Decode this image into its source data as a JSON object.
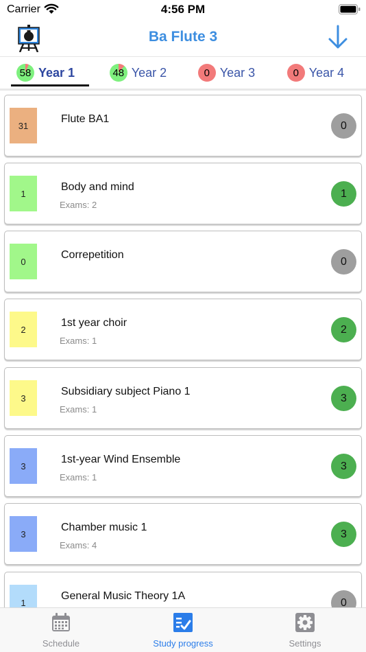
{
  "status_bar": {
    "carrier": "Carrier",
    "time": "4:56 PM"
  },
  "nav": {
    "title": "Ba Flute 3",
    "logo_icon": "easel-icon",
    "download_icon": "arrow-down-icon"
  },
  "year_tabs": [
    {
      "label": "Year 1",
      "count": "58",
      "active": true,
      "badge_color": "#7ef07e",
      "progress_color": "#f27a7a"
    },
    {
      "label": "Year 2",
      "count": "48",
      "active": false,
      "badge_color": "#7ef07e",
      "progress_color": "#f27a7a"
    },
    {
      "label": "Year 3",
      "count": "0",
      "active": false,
      "badge_color": "#f27a7a"
    },
    {
      "label": "Year 4",
      "count": "0",
      "active": false,
      "badge_color": "#f27a7a"
    }
  ],
  "courses": [
    {
      "name": "Flute BA1",
      "credits": "31",
      "exams": "",
      "count": "0",
      "color": "#ebb080",
      "count_color": "#9e9e9e"
    },
    {
      "name": "Body and mind",
      "credits": "1",
      "exams": "Exams: 2",
      "count": "1",
      "color": "#a1f78a",
      "count_color": "#4caf50"
    },
    {
      "name": "Correpetition",
      "credits": "0",
      "exams": "",
      "count": "0",
      "color": "#a1f78a",
      "count_color": "#9e9e9e"
    },
    {
      "name": "1st year choir",
      "credits": "2",
      "exams": "Exams: 1",
      "count": "2",
      "color": "#fdf98a",
      "count_color": "#4caf50"
    },
    {
      "name": "Subsidiary subject Piano 1",
      "credits": "3",
      "exams": "Exams: 1",
      "count": "3",
      "color": "#fdf98a",
      "count_color": "#4caf50"
    },
    {
      "name": "1st-year Wind Ensemble",
      "credits": "3",
      "exams": "Exams: 1",
      "count": "3",
      "color": "#8aabf8",
      "count_color": "#4caf50"
    },
    {
      "name": "Chamber music 1",
      "credits": "3",
      "exams": "Exams: 4",
      "count": "3",
      "color": "#8aabf8",
      "count_color": "#4caf50"
    },
    {
      "name": "General Music Theory 1A",
      "credits": "1",
      "exams": "",
      "count": "0",
      "color": "#b3dcfb",
      "count_color": "#9e9e9e"
    }
  ],
  "bottom_tabs": [
    {
      "label": "Schedule",
      "icon": "calendar-icon",
      "active": false
    },
    {
      "label": "Study progress",
      "icon": "checklist-icon",
      "active": true
    },
    {
      "label": "Settings",
      "icon": "gear-icon",
      "active": false
    }
  ],
  "colors": {
    "accent": "#3d8ee0",
    "tab_text": "#3a55a8",
    "active_bottom": "#2b7de9",
    "inactive_bottom": "#8e8e93"
  }
}
